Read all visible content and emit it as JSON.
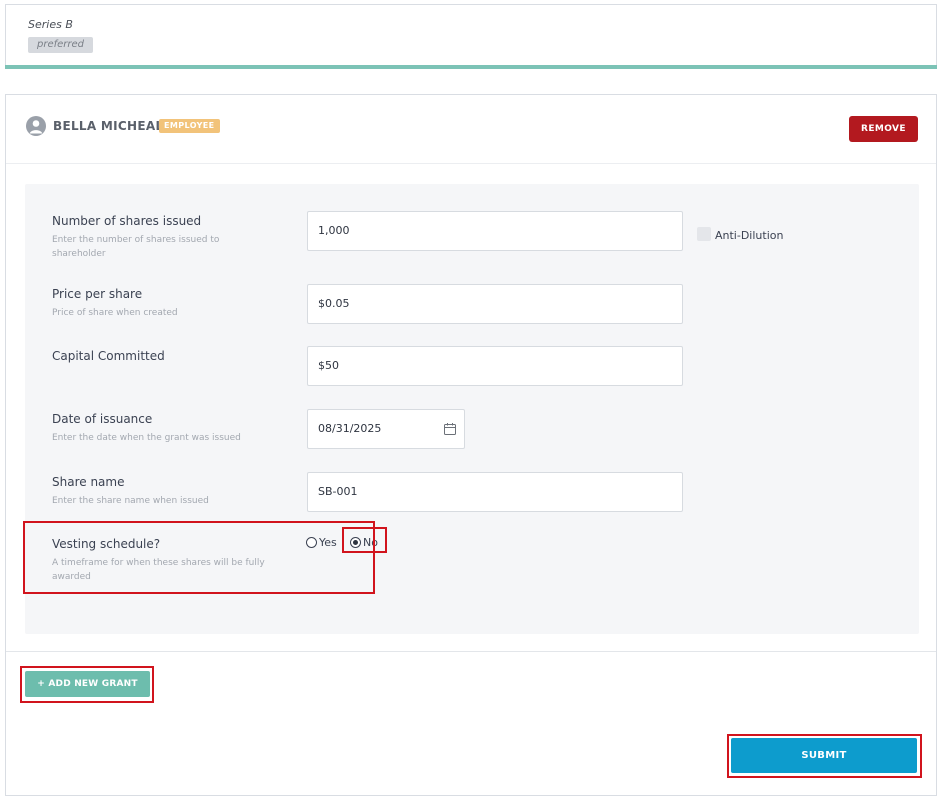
{
  "series_card": {
    "name": "Series B",
    "badge": "preferred"
  },
  "shareholder": {
    "name": "BELLA MICHEAL",
    "role_badge": "EMPLOYEE",
    "remove_label": "REMOVE"
  },
  "form": {
    "shares_issued": {
      "label": "Number of shares issued",
      "help": "Enter the number of shares issued to shareholder",
      "value": "1,000"
    },
    "anti_dilution": {
      "label": "Anti-Dilution",
      "checked": false
    },
    "price_per_share": {
      "label": "Price per share",
      "help": "Price of share when created",
      "value": "$0.05"
    },
    "capital_committed": {
      "label": "Capital Committed",
      "value": "$50"
    },
    "date_of_issuance": {
      "label": "Date of issuance",
      "help": "Enter the date when the grant was issued",
      "value": "08/31/2025"
    },
    "share_name": {
      "label": "Share name",
      "help": "Enter the share name when issued",
      "value": "SB-001"
    },
    "vesting_schedule": {
      "label": "Vesting schedule?",
      "help": "A timeframe for when these shares will be fully awarded",
      "options": [
        "Yes",
        "No"
      ],
      "selected": "No"
    }
  },
  "actions": {
    "add_grant_label": "+ ADD NEW GRANT",
    "submit_label": "SUBMIT"
  },
  "colors": {
    "accent_teal": "#7cc3b6",
    "remove_red": "#b3191f",
    "submit_blue": "#0d9ccd",
    "employee_badge": "#f2c37a",
    "highlight_red": "#d1141d"
  }
}
